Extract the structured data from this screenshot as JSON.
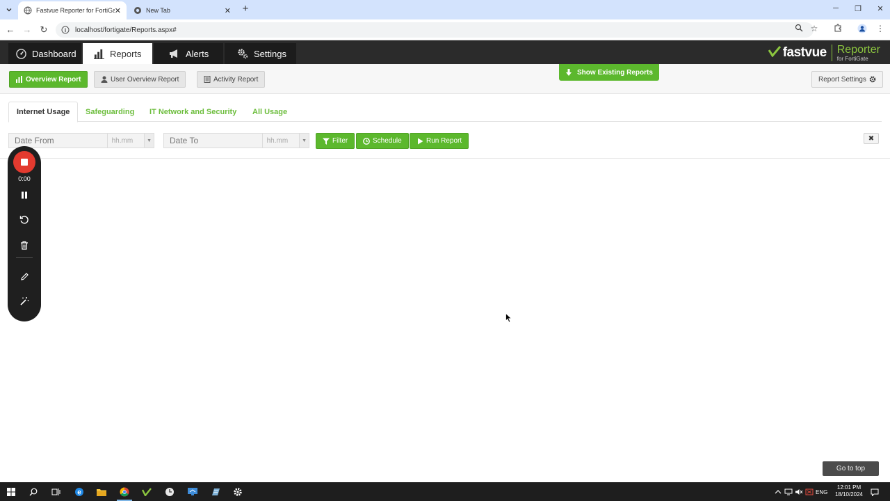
{
  "browser": {
    "tabs": [
      {
        "title": "Fastvue Reporter for FortiGate",
        "active": true
      },
      {
        "title": "New Tab",
        "active": false
      }
    ],
    "url": "localhost/fortigate/Reports.aspx#"
  },
  "app": {
    "main_tabs": [
      {
        "label": "Dashboard",
        "icon": "dashboard-icon"
      },
      {
        "label": "Reports",
        "icon": "bar-chart-icon",
        "active": true
      },
      {
        "label": "Alerts",
        "icon": "megaphone-icon"
      },
      {
        "label": "Settings",
        "icon": "gears-icon"
      }
    ],
    "logo": {
      "brand": "fastvue",
      "product": "Reporter",
      "product_sub": "for FortiGate"
    }
  },
  "report_bar": {
    "overview": "Overview Report",
    "user_overview": "User Overview Report",
    "activity": "Activity Report",
    "show_existing": "Show Existing Reports",
    "report_settings": "Report Settings"
  },
  "subtabs": [
    {
      "label": "Internet Usage",
      "active": true
    },
    {
      "label": "Safeguarding"
    },
    {
      "label": "IT Network and Security"
    },
    {
      "label": "All Usage"
    }
  ],
  "filters": {
    "date_from_placeholder": "Date From",
    "date_to_placeholder": "Date To",
    "time_placeholder": "hh.mm",
    "filter_label": "Filter",
    "schedule_label": "Schedule",
    "run_label": "Run Report"
  },
  "recorder": {
    "time": "0:00"
  },
  "go_top": "Go to top",
  "taskbar": {
    "lang": "ENG",
    "time": "12:01 PM",
    "date": "18/10/2024"
  },
  "colors": {
    "accent_green": "#5cb82d",
    "header_dark": "#2b2b2b",
    "record_red": "#e33a2f"
  }
}
